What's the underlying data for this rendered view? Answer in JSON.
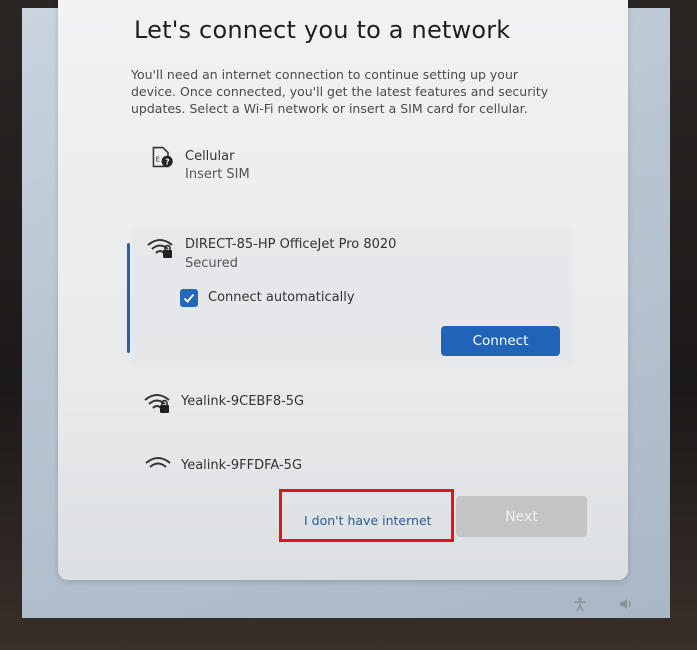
{
  "page": {
    "title": "Let's connect you to a network",
    "description": "You'll need an internet connection to continue setting up your device. Once connected, you'll get the latest features and security updates. Select a Wi-Fi network or insert a SIM card for cellular."
  },
  "networks": [
    {
      "name": "Cellular",
      "status": "Insert SIM",
      "icon": "cellular-sim-icon"
    },
    {
      "name": "DIRECT-85-HP OfficeJet Pro 8020",
      "status": "Secured",
      "icon": "wifi-secured-icon",
      "selected": true
    },
    {
      "name": "Yealink-9CEBF8-5G",
      "icon": "wifi-secured-icon"
    },
    {
      "name": "Yealink-9FFDFA-5G",
      "icon": "wifi-icon"
    }
  ],
  "selected_network": {
    "connect_automatically_label": "Connect automatically",
    "connect_automatically_checked": true,
    "connect_button_label": "Connect"
  },
  "footer": {
    "no_internet_label": "I don't have internet",
    "next_label": "Next"
  },
  "colors": {
    "accent": "#1f64b7",
    "highlight_box": "#e4141b",
    "disabled_button": "#c2c4c6"
  }
}
